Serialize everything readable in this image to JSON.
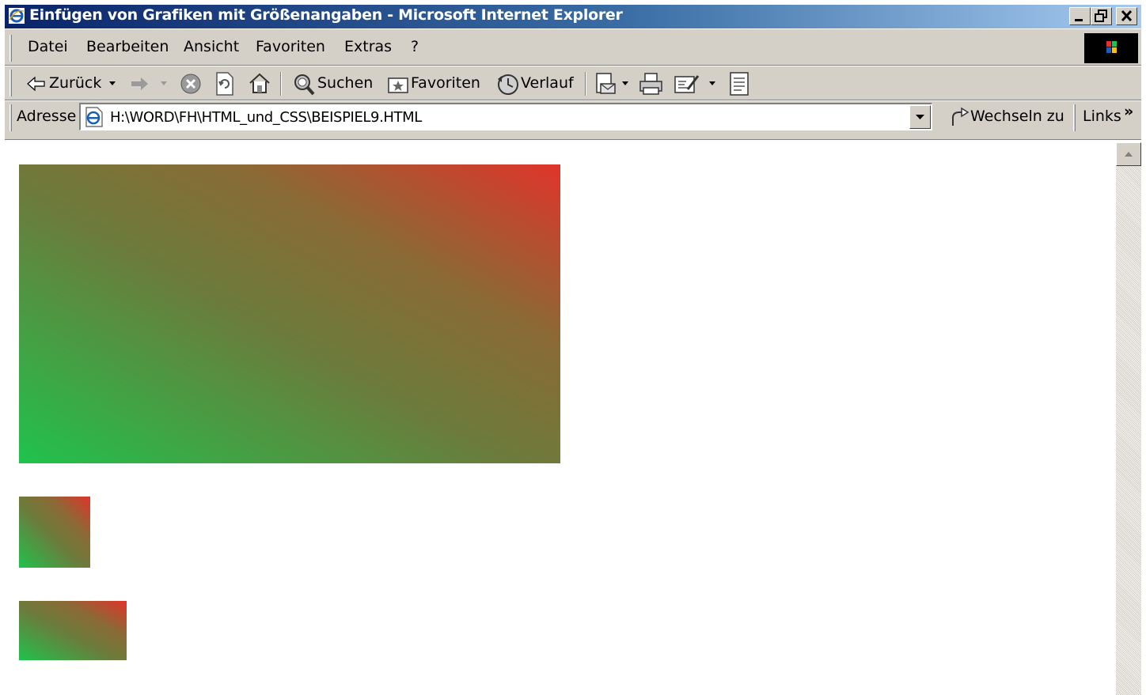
{
  "window": {
    "title": "Einfügen von Grafiken mit Größenangaben - Microsoft Internet Explorer"
  },
  "menu": {
    "items": [
      "Datei",
      "Bearbeiten",
      "Ansicht",
      "Favoriten",
      "Extras",
      "?"
    ]
  },
  "toolbar": {
    "back_label": "Zurück",
    "search_label": "Suchen",
    "favorites_label": "Favoriten",
    "history_label": "Verlauf"
  },
  "addressbar": {
    "label": "Adresse",
    "url": "H:\\WORD\\FH\\HTML_und_CSS\\BEISPIEL9.HTML",
    "go_label": "Wechseln zu",
    "links_label": "Links",
    "links_chevron": "»"
  },
  "colors": {
    "titlebar_start": "#0a246a",
    "titlebar_end": "#a6caf0",
    "chrome": "#d4d0c8",
    "gradient_green": "#20c24c",
    "gradient_red": "#e0342a"
  },
  "content": {
    "images": [
      {
        "name": "gradient-image-large"
      },
      {
        "name": "gradient-image-small-square"
      },
      {
        "name": "gradient-image-small-wide"
      }
    ]
  }
}
